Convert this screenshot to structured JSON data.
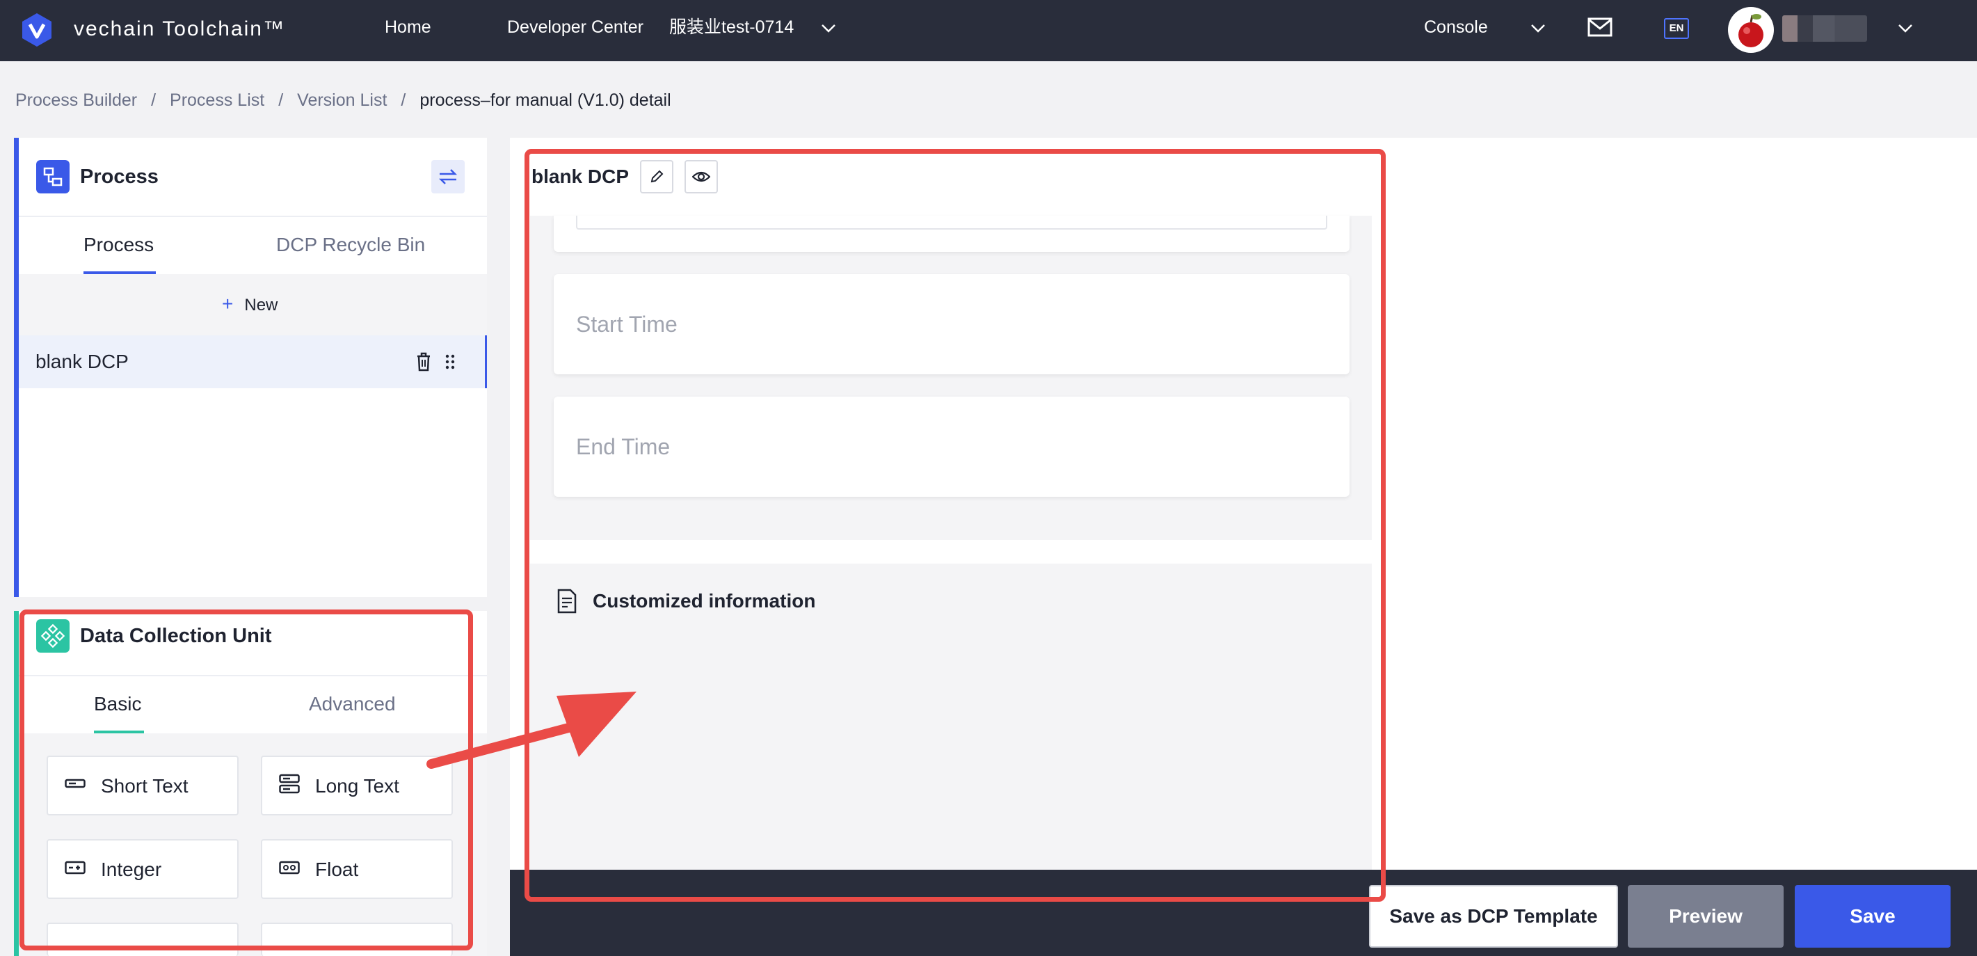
{
  "header": {
    "brand": "vechain Toolchain™",
    "nav": {
      "home": "Home",
      "developer_center": "Developer Center",
      "project": "服装业test-0714",
      "console": "Console"
    },
    "lang_badge": "EN"
  },
  "breadcrumb": [
    "Process Builder",
    "Process List",
    "Version List",
    "process–for manual (V1.0) detail"
  ],
  "process_panel": {
    "title": "Process",
    "tabs": [
      "Process",
      "DCP Recycle Bin"
    ],
    "active_tab": "Process",
    "new_label": "New",
    "items": [
      {
        "label": "blank DCP"
      }
    ]
  },
  "dcu_panel": {
    "title": "Data Collection Unit",
    "tabs": [
      "Basic",
      "Advanced"
    ],
    "active_tab": "Basic",
    "components": [
      "Short Text",
      "Long Text",
      "Integer",
      "Float"
    ]
  },
  "canvas": {
    "title": "blank DCP",
    "fields": [
      "Start Time",
      "End Time"
    ],
    "section_title": "Customized information"
  },
  "footer": {
    "save_template": "Save as DCP Template",
    "preview": "Preview",
    "save": "Save"
  },
  "colors": {
    "header_bg": "#292d3b",
    "accent": "#3a59e8",
    "teal": "#2bc4a3",
    "annotation": "#ea4b47",
    "preview_bg": "#7a7f90"
  },
  "icons": [
    "vechain-logo",
    "chevron-down-icon",
    "mail-icon",
    "language-icon",
    "avatar",
    "process-icon",
    "swap-icon",
    "plus-icon",
    "trash-icon",
    "drag-handle-icon",
    "dcu-icon",
    "short-text-icon",
    "long-text-icon",
    "integer-icon",
    "float-icon",
    "edit-icon",
    "eye-icon",
    "document-icon"
  ]
}
